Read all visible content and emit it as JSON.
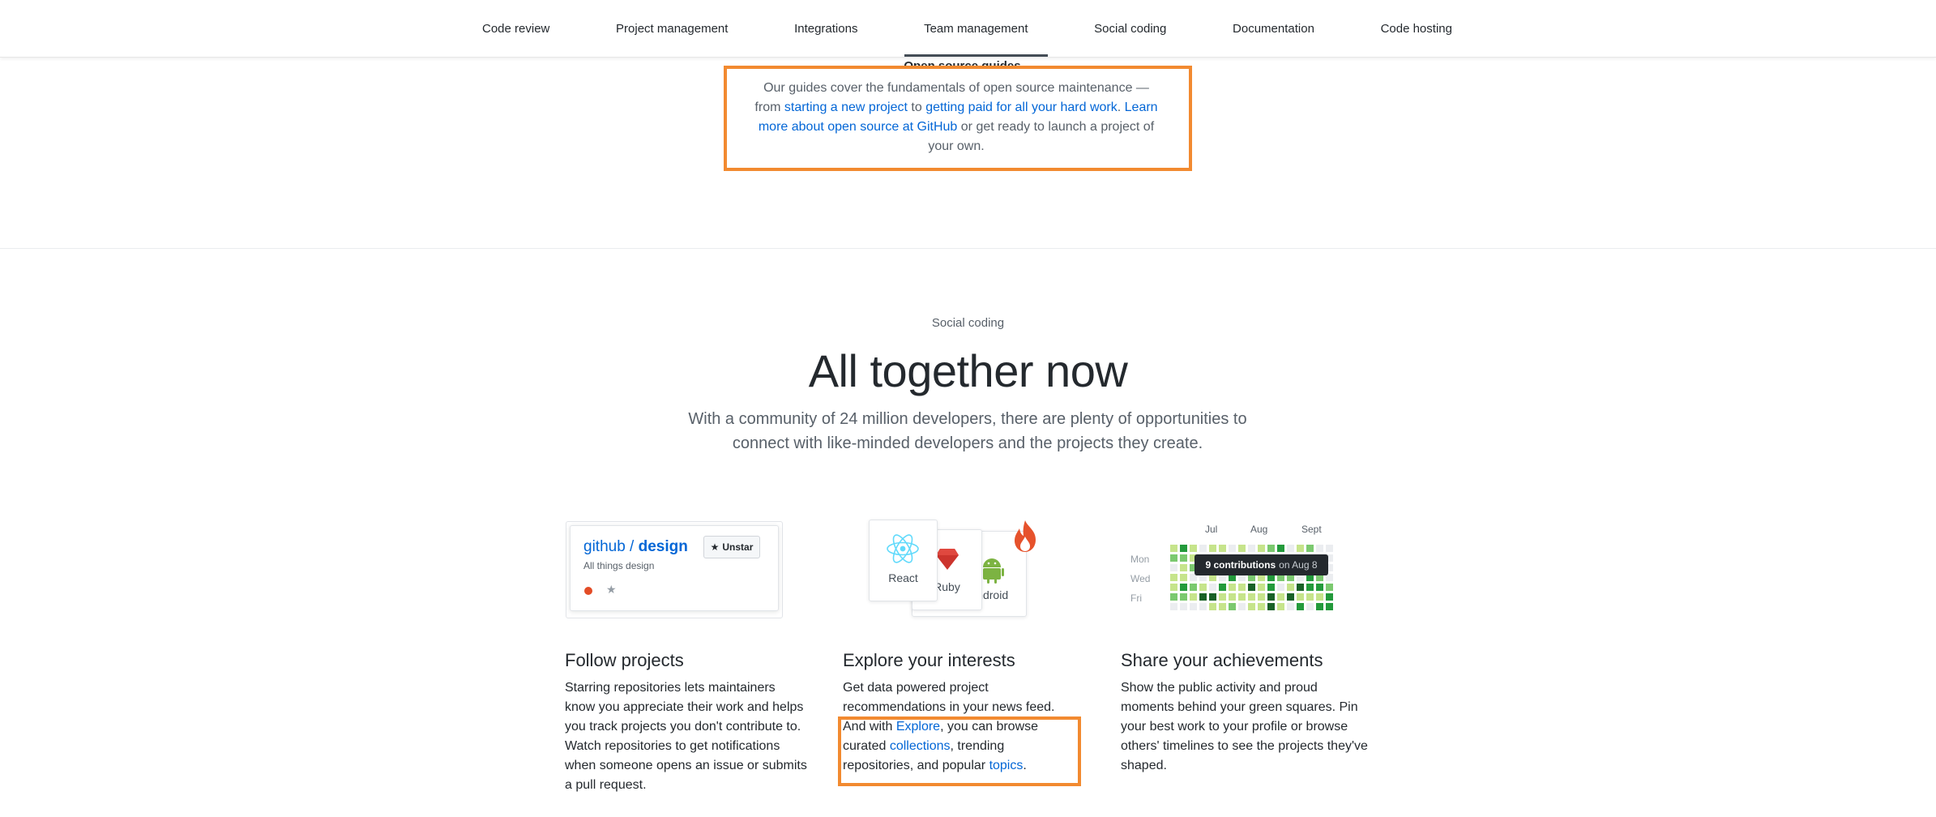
{
  "nav": {
    "items": [
      {
        "label": "Code review",
        "active": false
      },
      {
        "label": "Project management",
        "active": false
      },
      {
        "label": "Integrations",
        "active": false
      },
      {
        "label": "Team management",
        "active": true
      },
      {
        "label": "Social coding",
        "active": false
      },
      {
        "label": "Documentation",
        "active": false
      },
      {
        "label": "Code hosting",
        "active": false
      }
    ]
  },
  "guides": {
    "title": "Open source guides",
    "text_1": "Our guides cover the fundamentals of open source maintenance —from ",
    "link_1": "starting a new project",
    "text_2": " to ",
    "link_2": "getting paid for all your hard work",
    "text_3": ". ",
    "link_3": "Learn more about open source at GitHub",
    "text_4": " or get ready to launch a project of your own."
  },
  "social": {
    "eyebrow": "Social coding",
    "headline": "All together now",
    "lead": "With a community of 24 million developers, there are plenty of opportunities to connect with like-minded developers and the projects they create."
  },
  "repo_card": {
    "owner": "github",
    "separator": " / ",
    "name": "design",
    "description": "All things design",
    "unstar_label": "Unstar",
    "language_color": "#e34c26"
  },
  "topics": {
    "react": "React",
    "ruby": "Ruby",
    "android": "Android"
  },
  "contributions": {
    "months": [
      "Jul",
      "Aug",
      "Sept"
    ],
    "days": [
      "Mon",
      "Wed",
      "Fri"
    ],
    "tooltip_count": "9 contributions",
    "tooltip_date": "on Aug 8"
  },
  "features": {
    "follow": {
      "title": "Follow projects",
      "body": "Starring repositories lets maintainers know you appreciate their work and helps you track projects you don't contribute to. Watch repositories to get notifications when someone opens an issue or submits a pull request."
    },
    "explore": {
      "title": "Explore your interests",
      "body_1": "Get data powered project recommendations in your news feed. And with ",
      "link_explore": "Explore",
      "body_2": ", you can browse curated ",
      "link_collections": "collections",
      "body_3": ", trending repositories, and popular ",
      "link_topics": "topics",
      "body_4": "."
    },
    "share": {
      "title": "Share your achievements",
      "body": "Show the public activity and proud moments behind your green squares. Pin your best work to your profile or browse others' timelines to see the projects they've shaped."
    }
  },
  "colors": {
    "link": "#0366d6",
    "highlight": "#f28a30",
    "green_levels": [
      "#ebedf0",
      "#c6e48b",
      "#7bc96f",
      "#239a3b",
      "#196127"
    ]
  }
}
